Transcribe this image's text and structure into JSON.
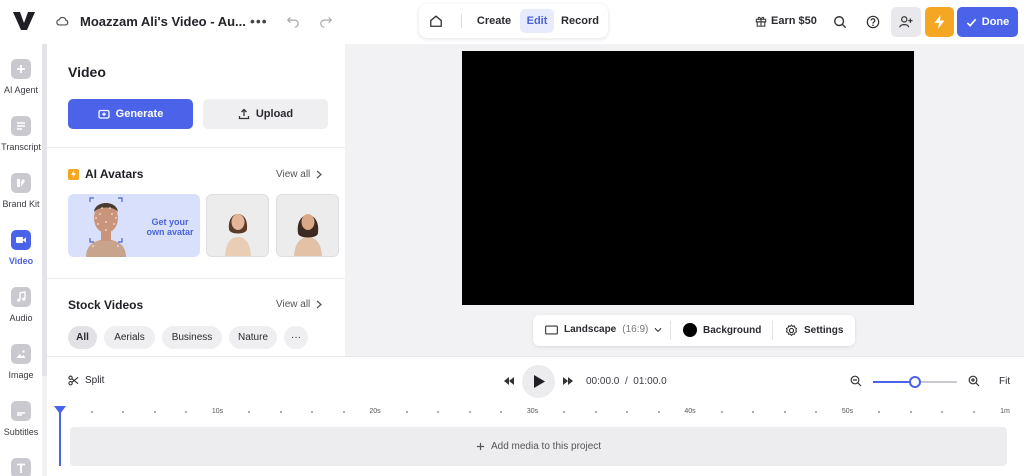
{
  "header": {
    "project_title": "Moazzam Ali's Video - Au...",
    "modes": [
      {
        "label": "Create",
        "active": false
      },
      {
        "label": "Edit",
        "active": true
      },
      {
        "label": "Record",
        "active": false
      }
    ],
    "earn_label": "Earn $50",
    "done_label": "Done",
    "accent_color": "#4b63e8",
    "upgrade_color": "#f5a623"
  },
  "rail": {
    "items": [
      {
        "label": "AI Agent",
        "icon": "plus-icon",
        "active": false
      },
      {
        "label": "Transcript",
        "icon": "transcript-icon",
        "active": false
      },
      {
        "label": "Brand Kit",
        "icon": "brand-kit-icon",
        "active": false
      },
      {
        "label": "Video",
        "icon": "video-camera-icon",
        "active": true
      },
      {
        "label": "Audio",
        "icon": "music-note-icon",
        "active": false
      },
      {
        "label": "Image",
        "icon": "image-icon",
        "active": false
      },
      {
        "label": "Subtitles",
        "icon": "subtitles-icon",
        "active": false
      },
      {
        "label": "",
        "icon": "text-icon",
        "active": false
      }
    ]
  },
  "panel": {
    "title": "Video",
    "generate_label": "Generate",
    "upload_label": "Upload",
    "avatars": {
      "title": "AI Avatars",
      "view_all": "View all",
      "cta_line1": "Get your",
      "cta_line2": "own avatar"
    },
    "stock": {
      "title": "Stock Videos",
      "view_all": "View all",
      "chips": [
        "All",
        "Aerials",
        "Business",
        "Nature"
      ],
      "more": "···"
    }
  },
  "canvas": {
    "layout_label": "Landscape",
    "layout_ratio": "(16:9)",
    "background_label": "Background",
    "settings_label": "Settings"
  },
  "timeline": {
    "split_label": "Split",
    "current_time": "00:00.0",
    "separator": "/",
    "total_time": "01:00.0",
    "fit_label": "Fit",
    "zoom_fraction": 0.5,
    "ruler_labels": [
      "10s",
      "20s",
      "30s",
      "40s",
      "50s",
      "1m"
    ],
    "add_media_label": "Add media to this project"
  }
}
